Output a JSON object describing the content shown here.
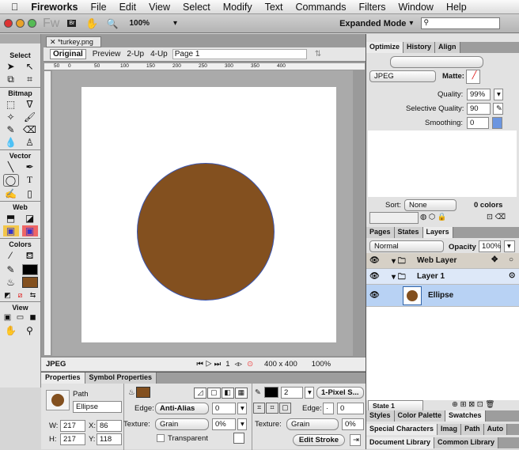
{
  "menubar": {
    "apple": "",
    "items": [
      "Fireworks",
      "File",
      "Edit",
      "View",
      "Select",
      "Modify",
      "Text",
      "Commands",
      "Filters",
      "Window",
      "Help"
    ]
  },
  "toolbar": {
    "logo": "Fw",
    "zoom": "100%",
    "mode": "Expanded Mode",
    "search_placeholder": ""
  },
  "tools": {
    "sections": [
      "Select",
      "Bitmap",
      "Vector",
      "Web",
      "Colors",
      "View"
    ],
    "stroke_color": "#000000",
    "fill_color": "#83501f"
  },
  "document": {
    "tab": "*turkey.png",
    "views": [
      "Original",
      "Preview",
      "2-Up",
      "4-Up"
    ],
    "page": "Page 1",
    "ruler_ticks": [
      "50",
      "0",
      "50",
      "100",
      "150",
      "200",
      "250",
      "300",
      "350",
      "400"
    ],
    "shape_color": "#83501f"
  },
  "status": {
    "format": "JPEG",
    "frame": "1",
    "size": "400 x 400",
    "zoom": "100%"
  },
  "properties": {
    "tabs": [
      "Properties",
      "Symbol Properties"
    ],
    "type": "Path",
    "name": "Ellipse",
    "w": "217",
    "h": "217",
    "x": "86",
    "y": "118",
    "edge_label": "Edge:",
    "edge": "Anti-Alias",
    "edge_value": "0",
    "texture_label": "Texture:",
    "texture": "Grain",
    "texture_pct": "0%",
    "transparent": "Transparent",
    "stroke_size": "2",
    "stroke_type": "1-Pixel S...",
    "stroke_edge": "0",
    "stroke_texture": "Grain",
    "stroke_texture_pct": "0%",
    "edit_stroke": "Edit Stroke"
  },
  "optimize": {
    "tabs": [
      "Optimize",
      "History",
      "Align"
    ],
    "format": "JPEG",
    "matte": "Matte:",
    "quality_label": "Quality:",
    "quality": "99%",
    "selective_label": "Selective Quality:",
    "selective": "90",
    "smoothing_label": "Smoothing:",
    "smoothing": "0",
    "sort_label": "Sort:",
    "sort": "None",
    "colors": "0 colors"
  },
  "layers": {
    "tabs": [
      "Pages",
      "States",
      "Layers"
    ],
    "blend": "Normal",
    "opacity_label": "Opacity",
    "opacity": "100%",
    "items": [
      "Web Layer",
      "Layer 1",
      "Ellipse"
    ],
    "state": "State 1"
  },
  "bottom_panels": {
    "row1": [
      "Styles",
      "Color Palette",
      "Swatches"
    ],
    "row2": [
      "Special Characters",
      "Imag",
      "Path",
      "Auto"
    ],
    "row3": [
      "Document Library",
      "Common Library"
    ]
  }
}
